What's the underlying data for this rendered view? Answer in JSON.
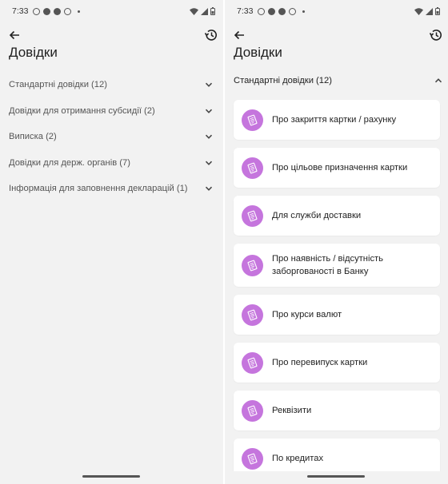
{
  "status": {
    "time": "7:33"
  },
  "header": {
    "title": "Довідки"
  },
  "categories": [
    {
      "label": "Стандартні довідки (12)"
    },
    {
      "label": "Довідки для отримання субсидії (2)"
    },
    {
      "label": "Виписка (2)"
    },
    {
      "label": "Довідки для держ. органів (7)"
    },
    {
      "label": "Інформація для заповнення декларацій (1)"
    }
  ],
  "expanded": {
    "label": "Стандартні довідки (12)",
    "items": [
      {
        "label": "Про закриття картки / рахунку"
      },
      {
        "label": "Про цільове призначення картки"
      },
      {
        "label": "Для служби доставки"
      },
      {
        "label": "Про наявність / відсутність заборгованості в Банку"
      },
      {
        "label": "Про курси валют"
      },
      {
        "label": "Про перевипуск картки"
      },
      {
        "label": "Реквізити"
      },
      {
        "label": "По кредитах"
      }
    ]
  },
  "colors": {
    "accent": "#c575dd",
    "background": "#f2f2f2",
    "card": "#ffffff"
  }
}
